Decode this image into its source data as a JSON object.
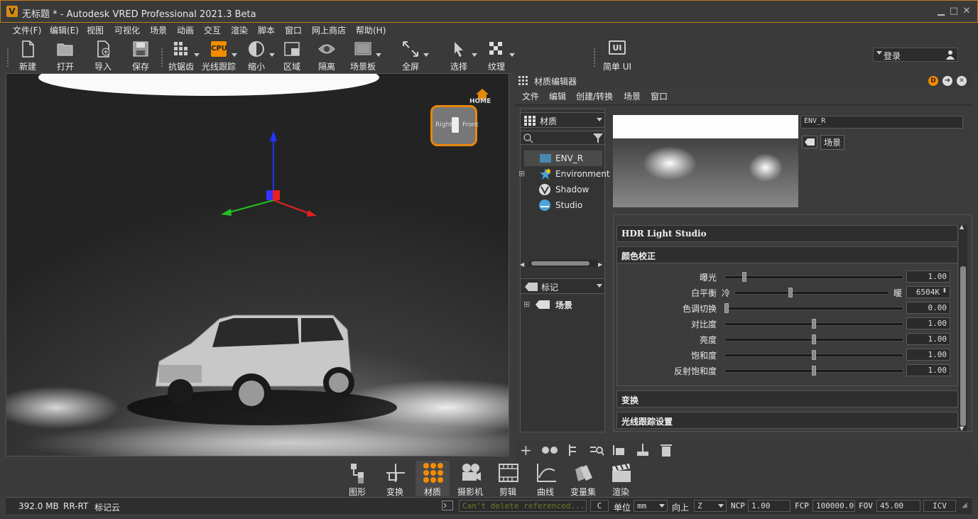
{
  "window": {
    "title": "无标题 * - Autodesk VRED Professional 2021.3 Beta",
    "logo": "V",
    "minimize": "▁",
    "maximize": "□",
    "close": "✕"
  },
  "menu": [
    "文件(F)",
    "编辑(E)",
    "视图",
    "可视化",
    "场景",
    "动画",
    "交互",
    "渲染",
    "脚本",
    "窗口",
    "网上商店",
    "帮助(H)"
  ],
  "toolbar": {
    "new": "新建",
    "open": "打开",
    "import": "导入",
    "save": "保存",
    "antialias": "抗锯齿",
    "raytrace": "光线跟踪",
    "raytrace_badge": "CPU",
    "zoom_out": "缩小",
    "region": "区域",
    "isolate": "隔离",
    "scene_board": "场景板",
    "fullscreen": "全屏",
    "select": "选择",
    "texture": "纹理",
    "simple_ui": "简单 UI",
    "simple_ui_badge": "UI"
  },
  "login": {
    "label": "登录"
  },
  "viewport": {
    "navcube_right": "Right",
    "navcube_front": "Front",
    "home_label": "HOME"
  },
  "material_editor": {
    "title": "材质编辑器",
    "menu": [
      "文件",
      "编辑",
      "创建/转换",
      "场景",
      "窗口"
    ],
    "filter_dropdown": "材质",
    "materials": [
      "ENV_R",
      "Environment",
      "Shadow",
      "Studio"
    ],
    "tag_dropdown": "标记",
    "tag_tree_item": "场景",
    "material_name": "ENV_R",
    "scene_tag": "场景",
    "sections": {
      "hdr": "HDR Light Studio",
      "color_correction": "颜色校正",
      "transform": "变换",
      "raytracing": "光线跟踪设置"
    },
    "sliders": [
      {
        "label": "曝光",
        "value": "1.00",
        "pos": 0.1
      },
      {
        "label": "白平衡",
        "value": "6504K",
        "pos": 0.36,
        "left_label": "冷",
        "right_label": "暖"
      },
      {
        "label": "色调切换",
        "value": "0.00",
        "pos": 0.0
      },
      {
        "label": "对比度",
        "value": "1.00",
        "pos": 0.5
      },
      {
        "label": "亮度",
        "value": "1.00",
        "pos": 0.5
      },
      {
        "label": "饱和度",
        "value": "1.00",
        "pos": 0.5
      },
      {
        "label": "反射饱和度",
        "value": "1.00",
        "pos": 0.5
      }
    ]
  },
  "dock": [
    "图形",
    "变换",
    "材质",
    "摄影机",
    "剪辑",
    "曲线",
    "变量集",
    "渲染"
  ],
  "status": {
    "memory": "392.0 MB",
    "mode": "RR-RT",
    "tag_cloud": "标记云",
    "message": "Can't delete referenced...",
    "clear_btn": "C",
    "unit_label": "单位",
    "unit": "mm",
    "up_label": "向上",
    "up": "Z",
    "ncp_label": "NCP",
    "ncp": "1.00",
    "fcp_label": "FCP",
    "fcp": "100000.00",
    "fov_label": "FOV",
    "fov": "45.00",
    "icv": "ICV"
  },
  "colors": {
    "accent": "#f28c00",
    "panel": "#3c3c3c",
    "viewport": "#1c1c1c"
  }
}
